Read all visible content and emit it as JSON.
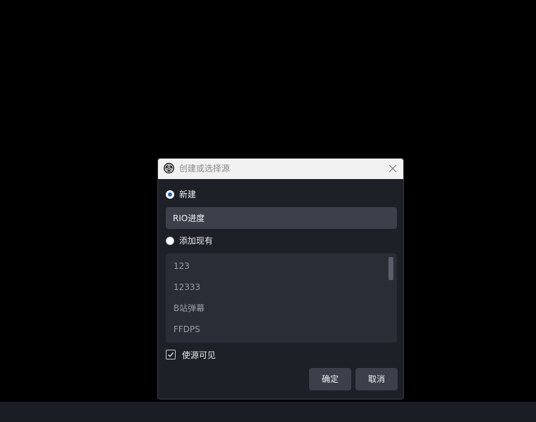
{
  "dialog": {
    "title": "创建或选择源",
    "close_icon": "close-icon",
    "app_icon": "obs-logo-icon"
  },
  "new_source": {
    "label": "新建",
    "selected": true,
    "name_value": "RIO进度"
  },
  "existing_source": {
    "label": "添加现有",
    "selected": false,
    "items": [
      "123",
      "12333",
      "B站弹幕",
      "FFDPS"
    ]
  },
  "visible_checkbox": {
    "label": "使源可见",
    "checked": true
  },
  "buttons": {
    "ok_label": "确定",
    "cancel_label": "取消"
  },
  "colors": {
    "accent": "#2f62b8",
    "dialog_bg": "#1e2027",
    "input_bg": "#3c404b"
  }
}
